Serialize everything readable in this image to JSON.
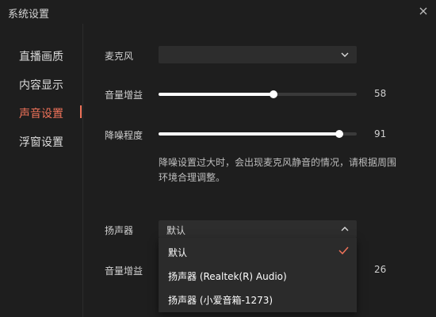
{
  "window": {
    "title": "系统设置"
  },
  "sidebar": {
    "items": [
      {
        "label": "直播画质",
        "active": false
      },
      {
        "label": "内容显示",
        "active": false
      },
      {
        "label": "声音设置",
        "active": true
      },
      {
        "label": "浮窗设置",
        "active": false
      }
    ]
  },
  "microphone": {
    "label": "麦克风",
    "selected": ""
  },
  "mic_volume": {
    "label": "音量增益",
    "value": "58",
    "percent": 58
  },
  "noise_reduction": {
    "label": "降噪程度",
    "value": "91",
    "percent": 91,
    "hint": "降噪设置过大时，会出现麦克风静音的情况，请根据周围环境合理调整。"
  },
  "speaker": {
    "label": "扬声器",
    "selected": "默认",
    "options": [
      {
        "label": "默认",
        "checked": true
      },
      {
        "label": "扬声器 (Realtek(R) Audio)",
        "checked": false
      },
      {
        "label": "扬声器 (小爱音箱-1273)",
        "checked": false
      }
    ]
  },
  "speaker_volume": {
    "label": "音量增益",
    "value": "26"
  },
  "colors": {
    "accent": "#f0735a",
    "background": "#1e1e1e",
    "control": "#2d2d2d"
  }
}
